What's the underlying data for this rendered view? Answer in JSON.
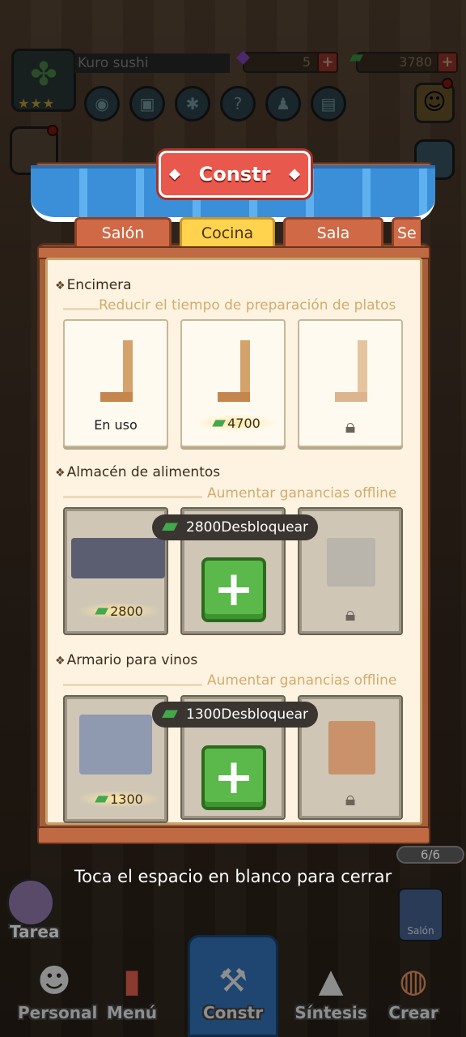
{
  "hud": {
    "shop_name": "Kuro sushi",
    "gems": "5",
    "cash": "3780",
    "stars": "★★★"
  },
  "panel": {
    "title": "Constr",
    "tabs": [
      {
        "label": "Salón",
        "active": false
      },
      {
        "label": "Cocina",
        "active": true
      },
      {
        "label": "Sala privada",
        "active": false
      },
      {
        "label": "Se",
        "active": false
      }
    ]
  },
  "sections": [
    {
      "title": "Encimera",
      "subtitle": "Reducir el tiempo de preparación de platos",
      "slots": [
        {
          "label": "En uso"
        },
        {
          "price": "4700"
        },
        {
          "locked": true
        }
      ]
    },
    {
      "title": "Almacén de alimentos",
      "subtitle": "Aumentar ganancias offline",
      "unlock": "2800Desbloquear",
      "slots": [
        {
          "price": "2800"
        },
        {
          "add": true
        },
        {
          "locked": true
        }
      ]
    },
    {
      "title": "Armario para vinos",
      "subtitle": "Aumentar ganancias offline",
      "unlock": "1300Desbloquear",
      "slots": [
        {
          "price": "1300"
        },
        {
          "add": true
        },
        {
          "locked": true
        }
      ]
    }
  ],
  "close_hint": "Toca el espacio en blanco para cerrar",
  "page_counter": "6/6",
  "side": {
    "tarea": "Tarea",
    "salon": "Salón"
  },
  "nav": [
    {
      "label": "Personal",
      "icon": "chef-icon"
    },
    {
      "label": "Menú",
      "icon": "menu-book-icon"
    },
    {
      "label": "Constr",
      "icon": "hammer-icon"
    },
    {
      "label": "Síntesis",
      "icon": "onigiri-icon"
    },
    {
      "label": "Crear",
      "icon": "sushi-icon"
    }
  ]
}
